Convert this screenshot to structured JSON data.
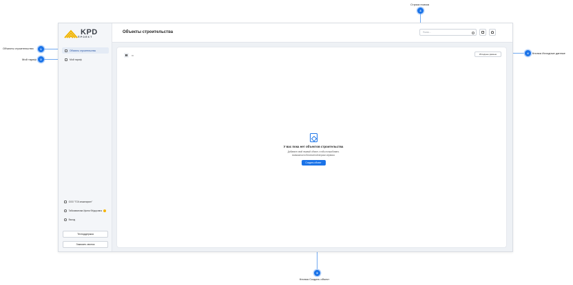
{
  "annotations": {
    "search": {
      "number": "3",
      "label": "Строка поиска"
    },
    "objects": {
      "number": "1",
      "label": "Объекты строительства"
    },
    "tariff": {
      "number": "2",
      "label": "Мой тариф"
    },
    "source": {
      "number": "4",
      "label": "Кнопка Исходные данные"
    },
    "create": {
      "number": "5",
      "label": "Кнопка Создать объект"
    }
  },
  "app": {
    "logo": {
      "word": "KPD",
      "sub": "ПРОЕКТ"
    },
    "page_title": "Объекты строительства",
    "search": {
      "placeholder": "Поиск..."
    },
    "sidebar": {
      "items": [
        {
          "label": "Объекты строительства",
          "active": true
        },
        {
          "label": "Мой тариф",
          "active": false
        }
      ],
      "footer": {
        "company": "ООО \"ГСК инжиниринг\"",
        "user": "Табалаватова Ирина Фёдоровна",
        "logout": "Выход",
        "support_button": "Техподдержка",
        "call_button": "Заказать звонок"
      }
    },
    "content": {
      "source_button": "Исходные данные",
      "empty": {
        "title": "У вас пока нет объектов строительства",
        "text_line1": "Добавьте свой первый объект, чтобы попробовать",
        "text_line2": "возможности бесплатной версии сервиса",
        "button": "Создать объект"
      }
    }
  },
  "colors": {
    "accent": "#1a73e8",
    "annotation_line": "#6fa8f0"
  }
}
